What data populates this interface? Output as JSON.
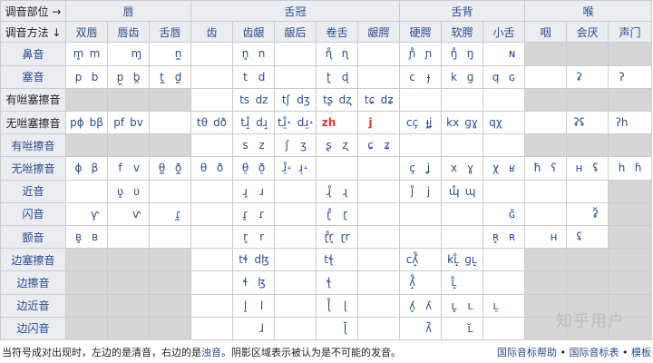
{
  "header": {
    "corner_place": "调音部位 →",
    "corner_manner": "调音方法 ↓",
    "places": [
      "唇",
      "舌冠",
      "舌背",
      "喉"
    ],
    "sub_places": [
      "双唇",
      "唇齿",
      "舌唇",
      "齿",
      "齿龈",
      "龈后",
      "卷舌",
      "龈腭",
      "硬腭",
      "软腭",
      "小舌",
      "咽",
      "会厌",
      "声门"
    ]
  },
  "rows": [
    {
      "manner": "鼻音",
      "cells": [
        [
          "m̥",
          "m"
        ],
        [
          "",
          "ɱ"
        ],
        [
          "",
          "n̼"
        ],
        [],
        [
          "n̥",
          "n"
        ],
        [],
        [
          "ɳ̊",
          "ɳ"
        ],
        [],
        [
          "ɲ̊",
          "ɲ"
        ],
        [
          "ŋ̊",
          "ŋ"
        ],
        [
          "",
          "ɴ"
        ],
        null,
        null,
        null
      ]
    },
    {
      "manner": "塞音",
      "cells": [
        [
          "p",
          "b"
        ],
        [
          "p̪",
          "b̪"
        ],
        [
          "t̼",
          "d̼"
        ],
        [],
        [
          "t",
          "d"
        ],
        [],
        [
          "ʈ",
          "ɖ"
        ],
        [],
        [
          "c",
          "ɟ"
        ],
        [
          "k",
          "ɡ"
        ],
        [
          "q",
          "ɢ"
        ],
        [],
        [
          "ʡ",
          ""
        ],
        [
          "ʔ",
          ""
        ]
      ]
    },
    {
      "manner": "有咝塞擦音",
      "cells": [
        null,
        null,
        null,
        [],
        [
          "ts",
          "dz"
        ],
        [
          "tʃ",
          "dʒ"
        ],
        [
          "tʂ",
          "dʐ"
        ],
        [
          "tɕ",
          "dʑ"
        ],
        [],
        [],
        [],
        null,
        null,
        null
      ]
    },
    {
      "manner": "无咝塞擦音",
      "cells": [
        [
          "pɸ",
          "bβ"
        ],
        [
          "pf",
          "bv"
        ],
        [],
        [
          "tθ",
          "dð"
        ],
        [
          "tɹ̝̊",
          "dɹ̝"
        ],
        [
          "tɹ̠̊˔",
          "dɹ̠˔"
        ],
        [
          "zh",
          ""
        ],
        [
          "j",
          ""
        ],
        [
          "cç",
          "ɟʝ"
        ],
        [
          "kx",
          "ɡɣ"
        ],
        [
          "qχ",
          ""
        ],
        [],
        [
          "ʡʢ",
          ""
        ],
        [
          "ʔh",
          ""
        ]
      ]
    },
    {
      "manner": "有咝擦音",
      "cells": [
        null,
        null,
        null,
        [],
        [
          "s",
          "z"
        ],
        [
          "ʃ",
          "ʒ"
        ],
        [
          "ʂ",
          "ʐ"
        ],
        [
          "ɕ",
          "ʑ"
        ],
        [],
        [],
        [],
        null,
        null,
        null
      ]
    },
    {
      "manner": "无咝擦音",
      "cells": [
        [
          "ɸ",
          "β"
        ],
        [
          "f",
          "v"
        ],
        [
          "θ̼",
          "ð̼"
        ],
        [
          "θ",
          "ð"
        ],
        [
          "θ̠",
          "ð̠"
        ],
        [
          "ɹ̠̊˔",
          "ɹ̠˔"
        ],
        [],
        [],
        [
          "ç",
          "ʝ"
        ],
        [
          "x",
          "ɣ"
        ],
        [
          "χ",
          "ʁ"
        ],
        [
          "ħ",
          "ʕ"
        ],
        [
          "ʜ",
          "ʢ"
        ],
        [
          "h",
          "ɦ"
        ]
      ]
    },
    {
      "manner": "近音",
      "cells": [
        [],
        [
          "ʋ̥",
          "ʋ"
        ],
        [],
        [],
        [
          "ɹ̥",
          "ɹ"
        ],
        [],
        [
          "ɻ̊",
          "ɻ"
        ],
        [],
        [
          "j̊",
          "j"
        ],
        [
          "ɰ̊",
          "ɰ"
        ],
        [],
        [],
        [],
        null
      ]
    },
    {
      "manner": "闪音",
      "cells": [
        [
          "",
          "ⱱ̟"
        ],
        [
          "",
          "ⱱ"
        ],
        [
          "",
          "ɾ̼"
        ],
        [],
        [
          "ɾ̥",
          "ɾ"
        ],
        [],
        [
          "ɽ̊",
          "ɽ"
        ],
        [],
        [],
        [],
        [
          "",
          "ɢ̆"
        ],
        [],
        [
          "",
          "ʡ̆"
        ],
        null
      ]
    },
    {
      "manner": "颤音",
      "cells": [
        [
          "ʙ̥",
          "ʙ"
        ],
        [],
        [],
        [],
        [
          "r̥",
          "r"
        ],
        [],
        [
          "ɽ̊r̥",
          "ɽr"
        ],
        [],
        [],
        [],
        [
          "ʀ̥",
          "ʀ"
        ],
        [
          "",
          "ʜ"
        ],
        [
          "ʢ",
          ""
        ],
        null
      ]
    },
    {
      "manner": "边塞擦音",
      "cells": [
        null,
        null,
        null,
        [],
        [
          "tɬ",
          "dɮ"
        ],
        [],
        [
          "tꞎ",
          ""
        ],
        [],
        [
          "cʎ̝̊",
          ""
        ],
        [
          "kʟ̝̊",
          "ɡʟ̝"
        ],
        [],
        null,
        null,
        null
      ]
    },
    {
      "manner": "边擦音",
      "cells": [
        null,
        null,
        null,
        [],
        [
          "ɬ",
          "ɮ"
        ],
        [],
        [
          "ꞎ",
          ""
        ],
        [],
        [
          "ʎ̝̊",
          ""
        ],
        [
          "ʟ̝̊",
          ""
        ],
        [],
        null,
        null,
        null
      ]
    },
    {
      "manner": "边近音",
      "cells": [
        null,
        null,
        null,
        [],
        [
          "l̥",
          "l"
        ],
        [],
        [
          "ɭ̊",
          "ɭ"
        ],
        [],
        [
          "ʎ̥",
          "ʎ"
        ],
        [
          "ʟ̥",
          "ʟ"
        ],
        [
          "ʟ̠",
          ""
        ],
        null,
        null,
        null
      ]
    },
    {
      "manner": "边闪音",
      "cells": [
        null,
        null,
        null,
        [],
        [
          "",
          "ɺ"
        ],
        [],
        [
          "",
          "ɭ̆"
        ],
        [],
        [
          "",
          "ʎ̆"
        ],
        [
          "",
          "ʟ̆"
        ],
        [],
        null,
        null,
        null
      ]
    }
  ],
  "footer": {
    "note_prefix": "当符号成对出现时，左边的是清音，右边的是",
    "note_voiced": "浊音",
    "note_suffix": "。阴影区域表示被认为是不可能的发音。",
    "links": [
      "国际音标帮助",
      "国际音标表",
      "模板"
    ]
  },
  "watermark": "知乎用户"
}
